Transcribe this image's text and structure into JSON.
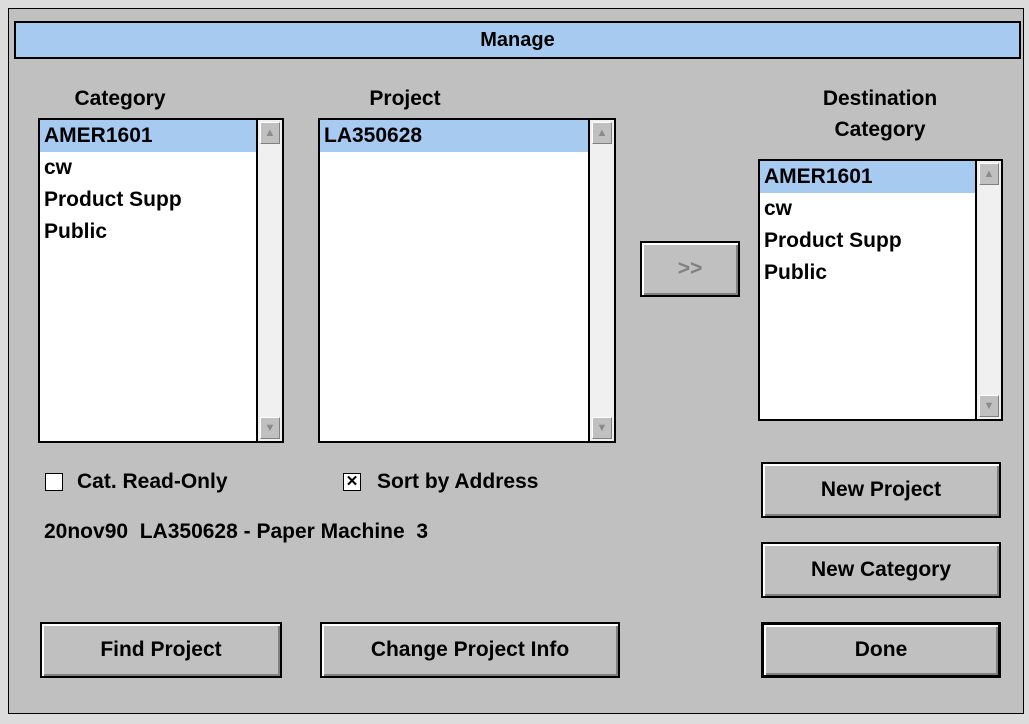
{
  "dialog": {
    "title": "Manage"
  },
  "category": {
    "label": "Category",
    "items": [
      "AMER1601",
      "cw",
      "Product Supp",
      "Public"
    ],
    "selected_index": 0
  },
  "project": {
    "label": "Project",
    "items": [
      "LA350628"
    ],
    "selected_index": 0
  },
  "destination": {
    "label_line1": "Destination",
    "label_line2": "Category",
    "items": [
      "AMER1601",
      "cw",
      "Product Supp",
      "Public"
    ],
    "selected_index": 0
  },
  "move_button_label": ">>",
  "checkboxes": {
    "cat_read_only": {
      "label": "Cat. Read-Only",
      "checked": false
    },
    "sort_by_address": {
      "label": "Sort by Address",
      "checked": true
    }
  },
  "status_text": "20nov90  LA350628 - Paper Machine  3",
  "buttons": {
    "new_project": "New Project",
    "new_category": "New Category",
    "find_project": "Find Project",
    "change_project_info": "Change Project Info",
    "done": "Done"
  },
  "icons": {
    "scroll_up": "up-arrow-icon",
    "scroll_down": "down-arrow-icon",
    "check": "x-check-icon"
  },
  "colors": {
    "selection": "#a6caf0",
    "titlebar": "#a6caf0",
    "dialog_face": "#c0c0c0"
  }
}
